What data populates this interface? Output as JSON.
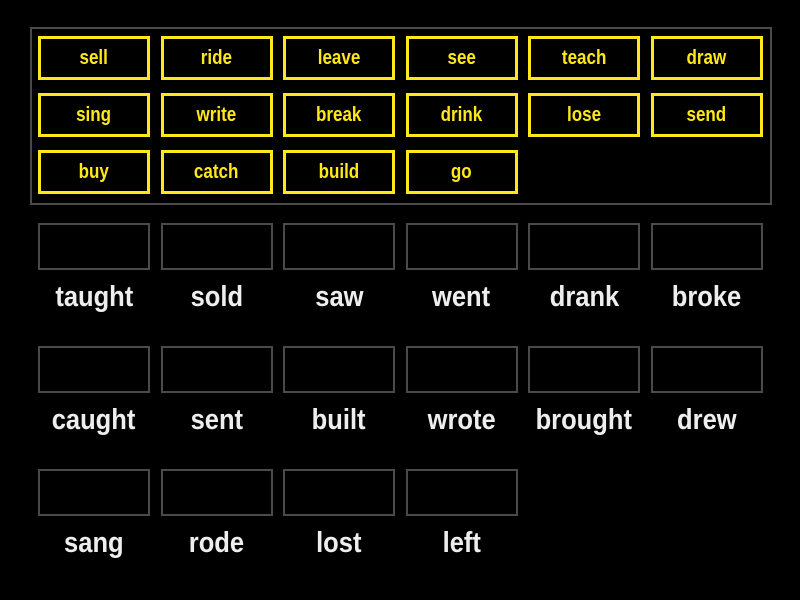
{
  "colors": {
    "tile": "#ffe81a",
    "label": "#eeeeee",
    "slot_border": "#4a4a4a",
    "background": "#000000"
  },
  "word_bank": [
    "sell",
    "ride",
    "leave",
    "see",
    "teach",
    "draw",
    "sing",
    "write",
    "break",
    "drink",
    "lose",
    "send",
    "buy",
    "catch",
    "build",
    "go"
  ],
  "targets": [
    "taught",
    "sold",
    "saw",
    "went",
    "drank",
    "broke",
    "caught",
    "sent",
    "built",
    "wrote",
    "brought",
    "drew",
    "sang",
    "rode",
    "lost",
    "left"
  ]
}
